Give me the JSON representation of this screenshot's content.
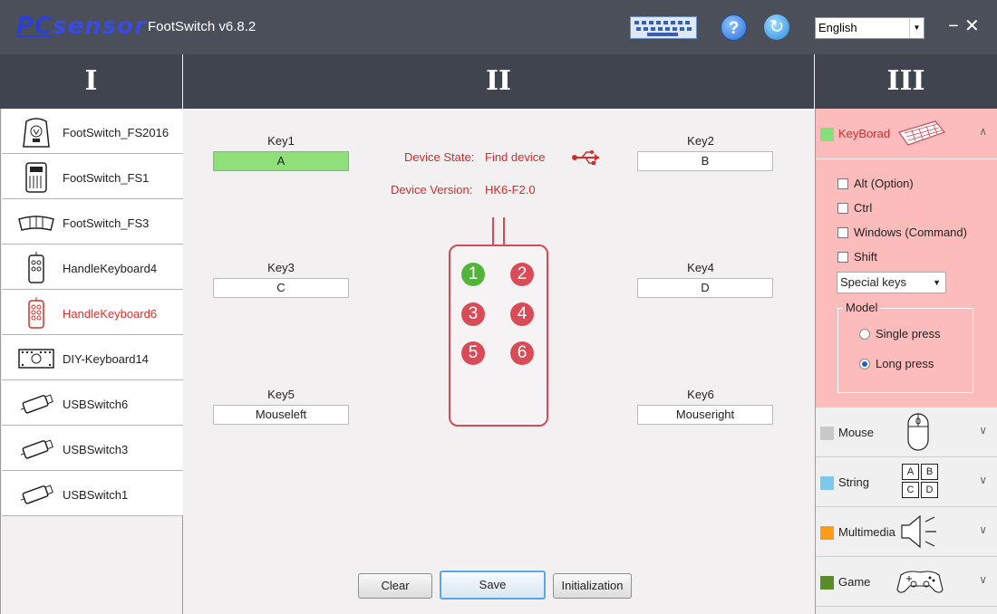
{
  "app": {
    "logo_pc": "PC",
    "logo_sensor": "sensor",
    "title": "FootSwitch v6.8.2",
    "language": "English"
  },
  "columns": {
    "left": "I",
    "center": "II",
    "right": "III"
  },
  "devices": [
    {
      "label": "FootSwitch_FS2016",
      "icon": "footswitch-fs2016-icon"
    },
    {
      "label": "FootSwitch_FS1",
      "icon": "footswitch-fs1-icon"
    },
    {
      "label": "FootSwitch_FS3",
      "icon": "footswitch-fs3-icon"
    },
    {
      "label": "HandleKeyboard4",
      "icon": "handle-keyboard4-icon"
    },
    {
      "label": "HandleKeyboard6",
      "icon": "handle-keyboard6-icon",
      "active": true
    },
    {
      "label": "DIY-Keyboard14",
      "icon": "diy-keyboard14-icon"
    },
    {
      "label": "USBSwitch6",
      "icon": "usb-switch6-icon"
    },
    {
      "label": "USBSwitch3",
      "icon": "usb-switch3-icon"
    },
    {
      "label": "USBSwitch1",
      "icon": "usb-switch1-icon"
    }
  ],
  "keys": [
    {
      "label": "Key1",
      "value": "A"
    },
    {
      "label": "Key2",
      "value": "B"
    },
    {
      "label": "Key3",
      "value": "C"
    },
    {
      "label": "Key4",
      "value": "D"
    },
    {
      "label": "Key5",
      "value": "Mouseleft"
    },
    {
      "label": "Key6",
      "value": "Mouseright"
    }
  ],
  "device_info": {
    "state_label": "Device State:",
    "state_value": "Find device",
    "version_label": "Device Version:",
    "version_value": "HK6-F2.0"
  },
  "pad_buttons": [
    "1",
    "2",
    "3",
    "4",
    "5",
    "6"
  ],
  "actions": {
    "clear": "Clear",
    "save": "Save",
    "init": "Initialization"
  },
  "panel": {
    "keyboard": {
      "title": "KeyBorad",
      "color": "#86e07a",
      "modifiers": [
        "Alt (Option)",
        "Ctrl",
        "Windows (Command)",
        "Shift"
      ],
      "special": "Special keys",
      "model_title": "Model",
      "model_options": [
        "Single press",
        "Long press"
      ]
    },
    "sections": [
      {
        "title": "Mouse",
        "color": "#c8c8c8"
      },
      {
        "title": "String",
        "color": "#7ec8ee"
      },
      {
        "title": "Multimedia",
        "color": "#ff9c1a"
      },
      {
        "title": "Game",
        "color": "#5a8a2a"
      }
    ],
    "string_keys": [
      "A",
      "B",
      "C",
      "D"
    ]
  },
  "colors": {
    "accent_red": "#d02d2d",
    "pad_red": "#d94b57",
    "panel_pink": "#fdbcbc"
  }
}
